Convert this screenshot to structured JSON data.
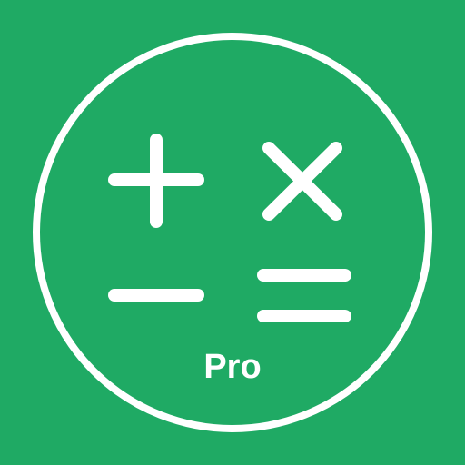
{
  "app_icon": {
    "background_color": "#1FAA64",
    "foreground_color": "#FFFFFF",
    "badge_text": "Pro",
    "glyphs": [
      "plus-icon",
      "multiply-icon",
      "minus-icon",
      "equals-icon"
    ]
  }
}
